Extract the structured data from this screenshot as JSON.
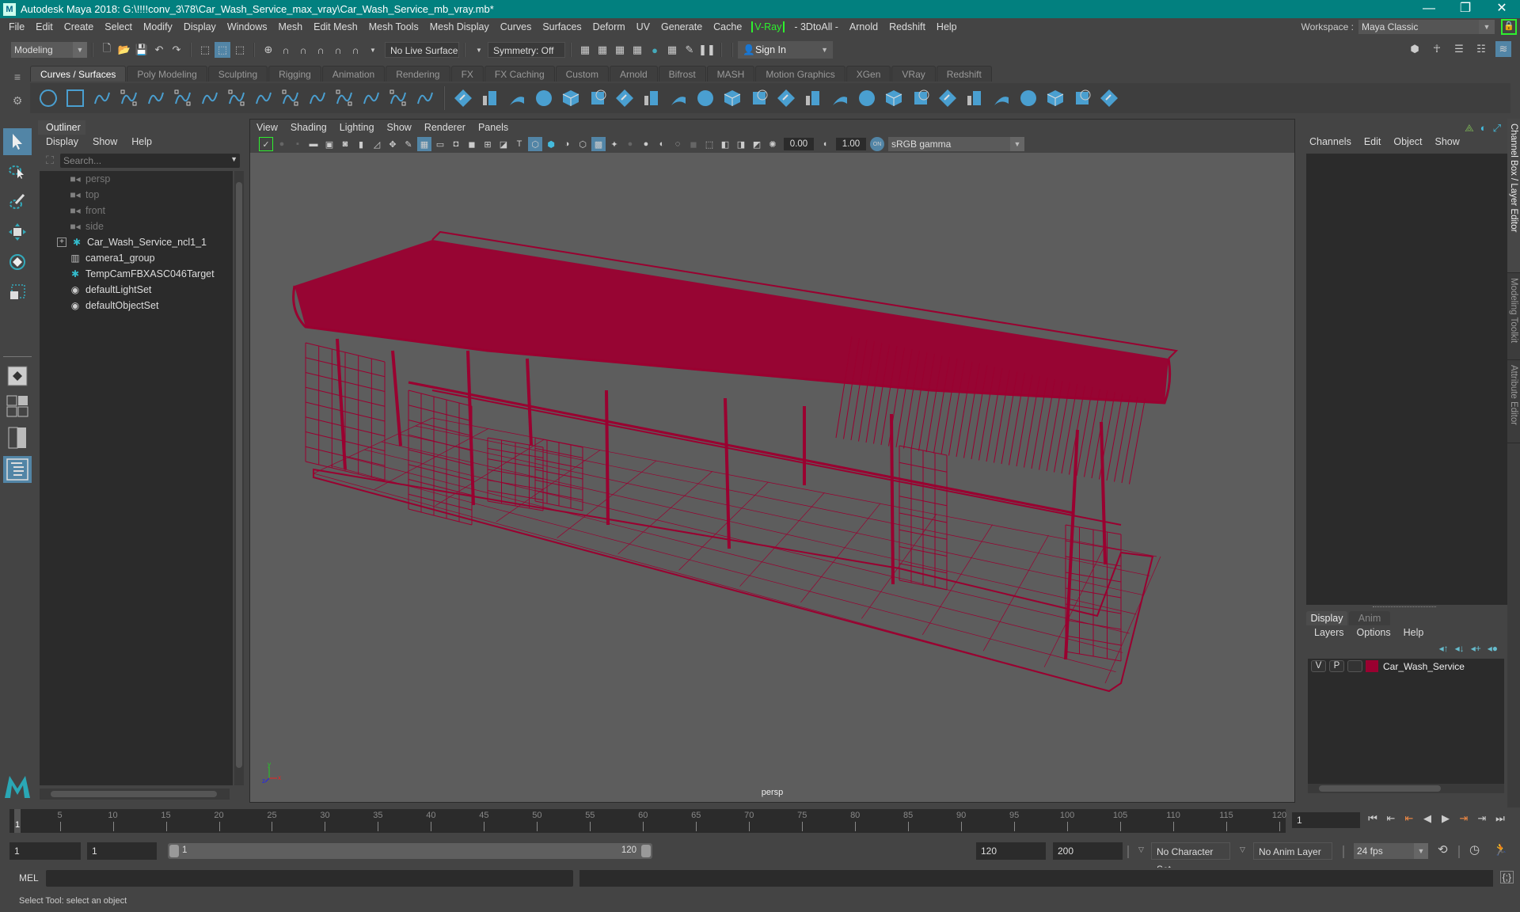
{
  "window": {
    "title": "Autodesk Maya 2018: G:\\!!!!conv_3\\78\\Car_Wash_Service_max_vray\\Car_Wash_Service_mb_vray.mb*",
    "controls": {
      "minimize": "—",
      "maximize": "❐",
      "close": "✕"
    }
  },
  "menubar": {
    "items": [
      "File",
      "Edit",
      "Create",
      "Select",
      "Modify",
      "Display",
      "Windows",
      "Mesh",
      "Edit Mesh",
      "Mesh Tools",
      "Mesh Display",
      "Curves",
      "Surfaces",
      "Deform",
      "UV",
      "Generate",
      "Cache",
      "V-Ray",
      "- 3DtoAll -",
      "Arnold",
      "Redshift",
      "Help"
    ],
    "highlight_item": "V-Ray",
    "highlight_color": "#2ef02e"
  },
  "workspace": {
    "label": "Workspace :",
    "value": "Maya Classic"
  },
  "statusline": {
    "mode": "Modeling",
    "live_surface": "No Live Surface",
    "symmetry": "Symmetry: Off",
    "sign_in": "Sign In"
  },
  "shelf": {
    "tabs": [
      "Curves / Surfaces",
      "Poly Modeling",
      "Sculpting",
      "Rigging",
      "Animation",
      "Rendering",
      "FX",
      "FX Caching",
      "Custom",
      "Arnold",
      "Bifrost",
      "MASH",
      "Motion Graphics",
      "XGen",
      "VRay",
      "Redshift"
    ],
    "active_tab": "Curves / Surfaces",
    "icons": [
      "nurbs-circle",
      "nurbs-square",
      "cv-curve",
      "pencil-curve",
      "arc-tool",
      "ep-curve",
      "bezier-curve",
      "curve-cut",
      "curve-attach",
      "curve-extend",
      "curve-offset",
      "rebuild-curve",
      "detach-curve",
      "curve-fillet",
      "insert-knot",
      "nurbs-sphere",
      "nurbs-cube",
      "nurbs-cylinder",
      "nurbs-cone",
      "nurbs-plane-diamond",
      "nurbs-torus",
      "revolve",
      "loft",
      "planar",
      "extrude",
      "birail",
      "boundary",
      "square-surface",
      "bevel-plus",
      "surface-fillet",
      "project-curve",
      "intersect",
      "trim",
      "untrim",
      "attach-surface",
      "detach-surface",
      "align-surface",
      "rebuild-surface",
      "sculpt-geometry",
      "surface-editing"
    ]
  },
  "outliner": {
    "title": "Outliner",
    "menu": [
      "Display",
      "Show",
      "Help"
    ],
    "search_placeholder": "Search...",
    "items": [
      {
        "label": "persp",
        "icon": "camera-icon",
        "dim": true
      },
      {
        "label": "top",
        "icon": "camera-icon",
        "dim": true
      },
      {
        "label": "front",
        "icon": "camera-icon",
        "dim": true
      },
      {
        "label": "side",
        "icon": "camera-icon",
        "dim": true
      },
      {
        "label": "Car_Wash_Service_ncl1_1",
        "icon": "locator-icon",
        "dim": false,
        "expandable": true
      },
      {
        "label": "camera1_group",
        "icon": "group-icon",
        "dim": false
      },
      {
        "label": "TempCamFBXASC046Target",
        "icon": "locator-icon",
        "dim": false
      },
      {
        "label": "defaultLightSet",
        "icon": "set-icon",
        "dim": false
      },
      {
        "label": "defaultObjectSet",
        "icon": "set-icon",
        "dim": false
      }
    ]
  },
  "viewport": {
    "menu": [
      "View",
      "Shading",
      "Lighting",
      "Show",
      "Renderer",
      "Panels"
    ],
    "exposure": "0.00",
    "gamma": "1.00",
    "color_space": "sRGB gamma",
    "color_mgmt": "ON",
    "camera_label": "persp",
    "wire_color": "#9a0030",
    "axis": {
      "x": "x",
      "y": "y",
      "z": "z"
    }
  },
  "channelbox": {
    "menu": [
      "Channels",
      "Edit",
      "Object",
      "Show"
    ]
  },
  "side_tabs": [
    "Channel Box / Layer Editor",
    "Modeling Toolkit",
    "Attribute Editor"
  ],
  "layer_editor": {
    "tabs": [
      "Display",
      "Anim"
    ],
    "active_tab": "Display",
    "menu": [
      "Layers",
      "Options",
      "Help"
    ],
    "layers": [
      {
        "visible": "V",
        "playback": "P",
        "type": "",
        "color": "#9a0030",
        "name": "Car_Wash_Service"
      }
    ]
  },
  "timeline": {
    "start": 1,
    "end": 120,
    "ticks": [
      5,
      10,
      15,
      20,
      25,
      30,
      35,
      40,
      45,
      50,
      55,
      60,
      65,
      70,
      75,
      80,
      85,
      90,
      95,
      100,
      105,
      110,
      115,
      120
    ],
    "current_frame": "1",
    "current_frame_marker": "1"
  },
  "range": {
    "start_time": "1",
    "playback_start": "1",
    "slider_start": "1",
    "slider_end": "120",
    "playback_end": "120",
    "end_time": "200",
    "character_set": "No Character Set",
    "anim_layer": "No Anim Layer",
    "fps": "24 fps"
  },
  "cmdline": {
    "label": "MEL"
  },
  "helpline": {
    "text": "Select Tool: select an object"
  }
}
